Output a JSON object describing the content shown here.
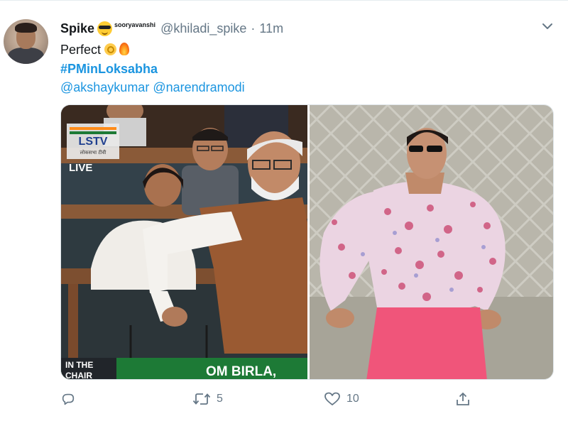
{
  "tweet": {
    "display_name": "Spike",
    "name_superscript": "sooryavanshi",
    "handle": "@khiladi_spike",
    "separator": "·",
    "time": "11m",
    "text": "Perfect",
    "hashtag": "#PMinLoksabha",
    "mentions": "@akshaykumar @narendramodi"
  },
  "media": {
    "left_overlay": {
      "channel": "LSTV",
      "channel_sub": "लोकसभा टीवी",
      "live": "LIVE",
      "in_the": "IN THE",
      "chair": "CHAIR",
      "speaker": "OM BIRLA,"
    }
  },
  "actions": {
    "reply_count": "",
    "retweet_count": "5",
    "like_count": "10"
  },
  "icons": {
    "avatar": "avatar",
    "verified_emoji": "smiling-face-sunglasses-icon",
    "ok_emoji": "ok-hand-icon",
    "fire_emoji": "fire-icon",
    "more": "chevron-down-icon",
    "reply": "reply-icon",
    "retweet": "retweet-icon",
    "like": "heart-icon",
    "share": "share-icon"
  },
  "colors": {
    "link": "#1b95e0",
    "muted": "#657786",
    "text": "#14171a",
    "ticker_green": "#1d7a36"
  }
}
